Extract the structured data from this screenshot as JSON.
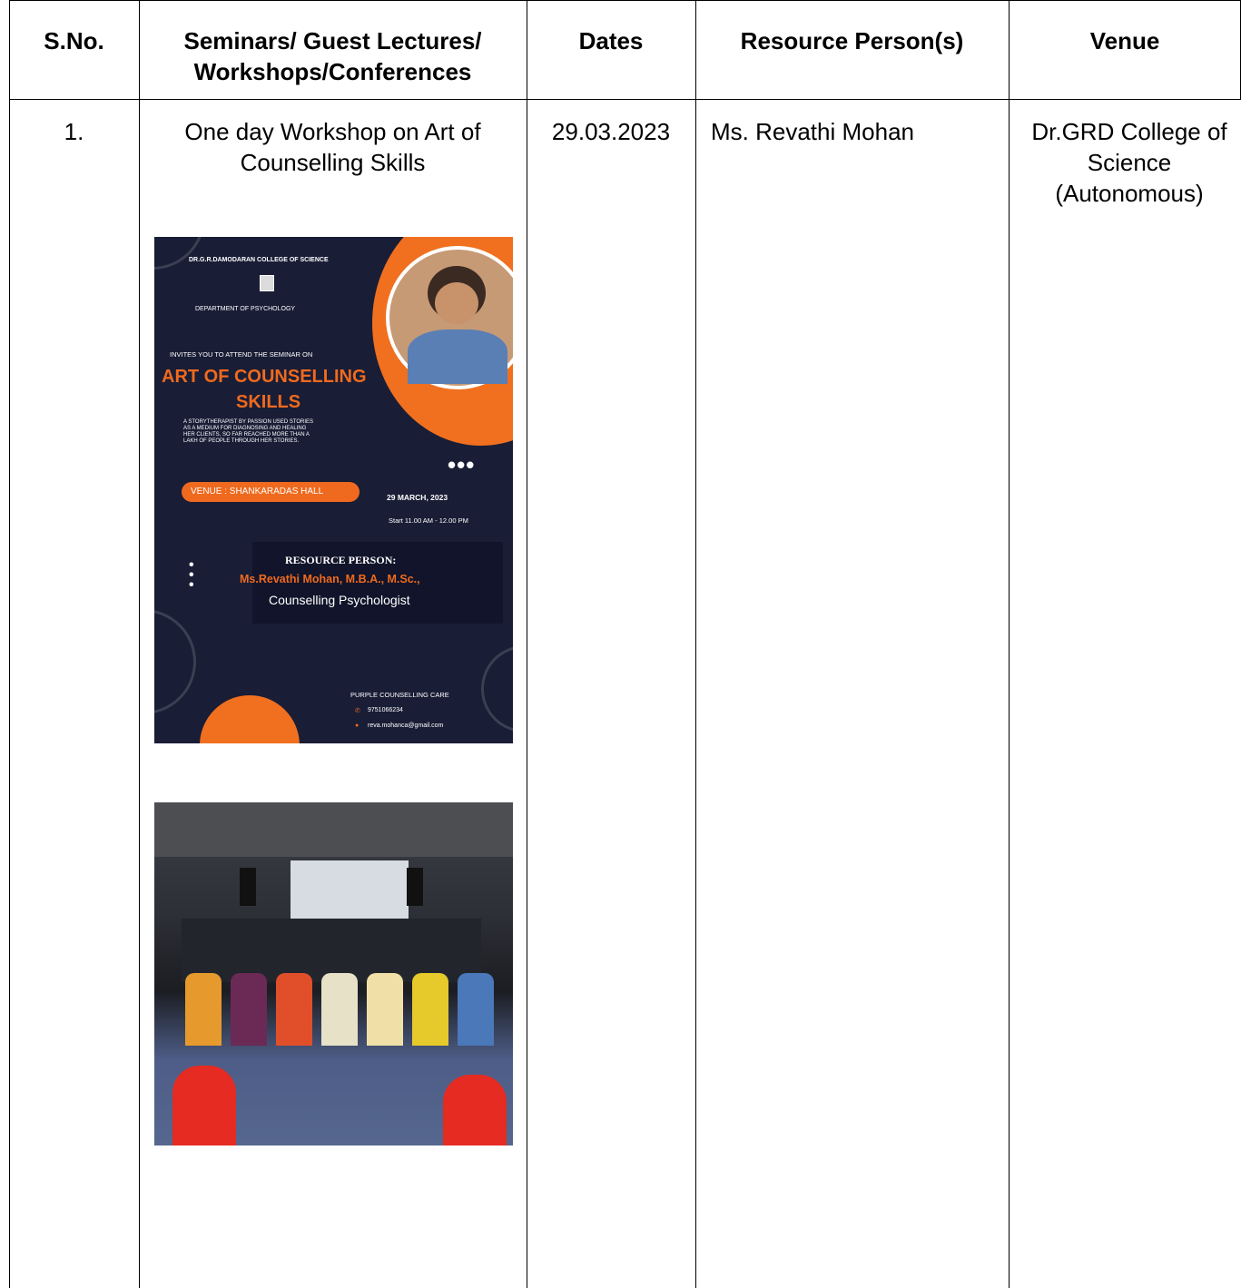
{
  "table": {
    "headers": {
      "sno": "S.No.",
      "event": "Seminars/ Guest Lectures/ Workshops/Conferences",
      "dates": "Dates",
      "resource": "Resource Person(s)",
      "venue": "Venue"
    },
    "rows": [
      {
        "sno": "1.",
        "event": "One day Workshop on Art of Counselling Skills",
        "date": "29.03.2023",
        "resource": "Ms. Revathi Mohan",
        "venue": "Dr.GRD College of Science (Autonomous)"
      }
    ]
  },
  "poster": {
    "college": "DR.G.R.DAMODARAN COLLEGE OF SCIENCE",
    "department": "DEPARTMENT OF PSYCHOLOGY",
    "invite": "INVITES YOU TO ATTEND THE SEMINAR ON",
    "title_line1": "ART OF COUNSELLING",
    "title_line2": "SKILLS",
    "blurb_line1": "A STORYTHERAPIST BY PASSION USED STORIES",
    "blurb_line2": "AS A MEDIUM FOR DIAGNOSING AND HEALING",
    "blurb_line3": "HER CLIENTS, SO FAR REACHED MORE THAN A",
    "blurb_line4": "LAKH OF PEOPLE THROUGH HER STORIES.",
    "venue": "VENUE : SHANKARADAS HALL",
    "date": "29 MARCH, 2023",
    "time": "Start 11.00 AM - 12.00 PM",
    "resource_label": "RESOURCE PERSON:",
    "resource_name": "Ms.Revathi Mohan, M.B.A., M.Sc.,",
    "resource_role": "Counselling Psychologist",
    "org": "PURPLE COUNSELLING CARE",
    "phone": "9751066234",
    "email": "reva.mohanca@gmail.com",
    "colors": {
      "background": "#191d36",
      "accent": "#ef6a1e"
    }
  }
}
